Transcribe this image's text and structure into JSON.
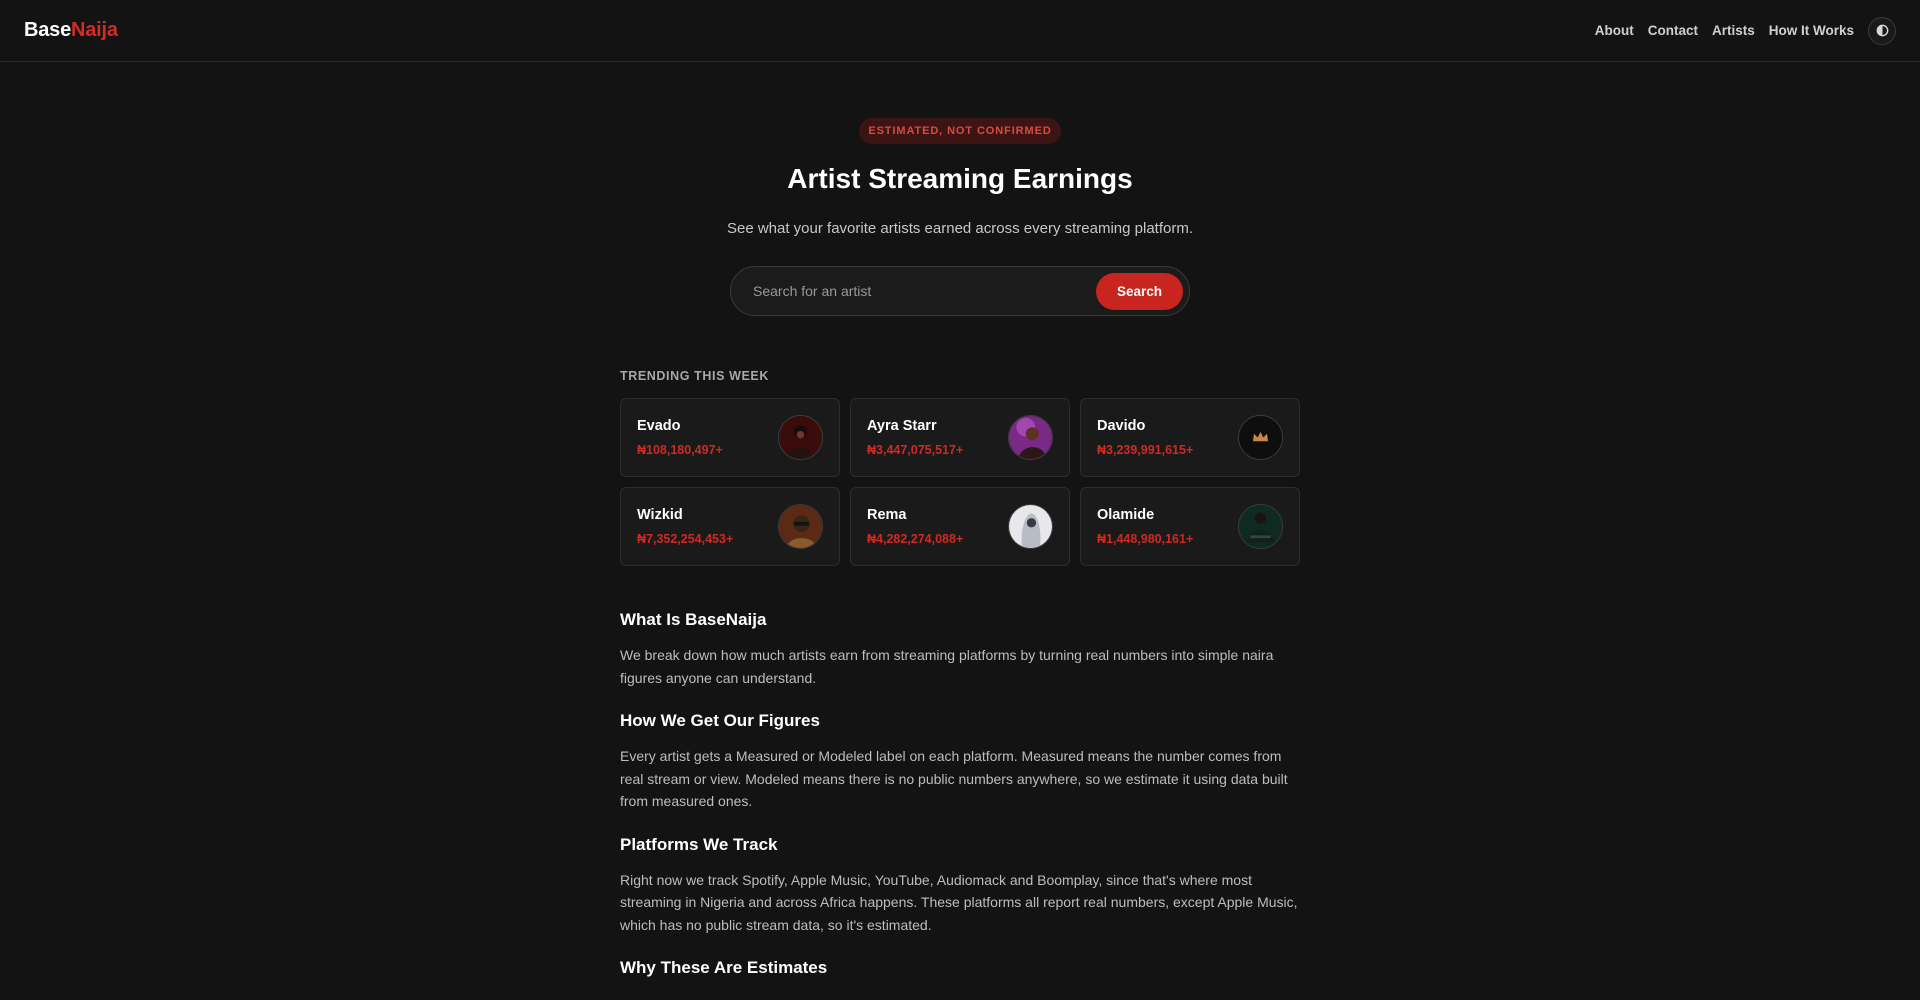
{
  "header": {
    "logo_base": "Base",
    "logo_naija": "Naija",
    "nav": [
      "About",
      "Contact",
      "Artists",
      "How It Works"
    ],
    "theme_toggle_icon": "half-circle-contrast-icon"
  },
  "hero": {
    "badge": "ESTIMATED, NOT CONFIRMED",
    "title": "Artist Streaming Earnings",
    "subtitle": "See what your favorite artists earned across every streaming platform.",
    "search_placeholder": "Search for an artist",
    "search_button": "Search"
  },
  "trending": {
    "label": "TRENDING THIS WEEK",
    "artists": [
      {
        "name": "Evado",
        "amount": "₦108,180,497+"
      },
      {
        "name": "Ayra Starr",
        "amount": "₦3,447,075,517+"
      },
      {
        "name": "Davido",
        "amount": "₦3,239,991,615+"
      },
      {
        "name": "Wizkid",
        "amount": "₦7,352,254,453+"
      },
      {
        "name": "Rema",
        "amount": "₦4,282,274,088+"
      },
      {
        "name": "Olamide",
        "amount": "₦1,448,980,161+"
      }
    ]
  },
  "sections": [
    {
      "title": "What Is BaseNaija",
      "body": "We break down how much artists earn from streaming platforms by turning real numbers into simple naira figures anyone can understand."
    },
    {
      "title": "How We Get Our Figures",
      "body": "Every artist gets a Measured or Modeled label on each platform. Measured means the number comes from real stream or view. Modeled means there is no public numbers anywhere, so we estimate it using data built from measured ones."
    },
    {
      "title": "Platforms We Track",
      "body": "Right now we track Spotify, Apple Music, YouTube, Audiomack and Boomplay, since that's where most streaming in Nigeria and across Africa happens. These platforms all report real numbers, except Apple Music, which has no public stream data, so it's estimated."
    },
    {
      "title": "Why These Are Estimates",
      "body": ""
    }
  ],
  "colors": {
    "background": "#131313",
    "accent": "#c8251f",
    "card": "#1a1a1a"
  }
}
